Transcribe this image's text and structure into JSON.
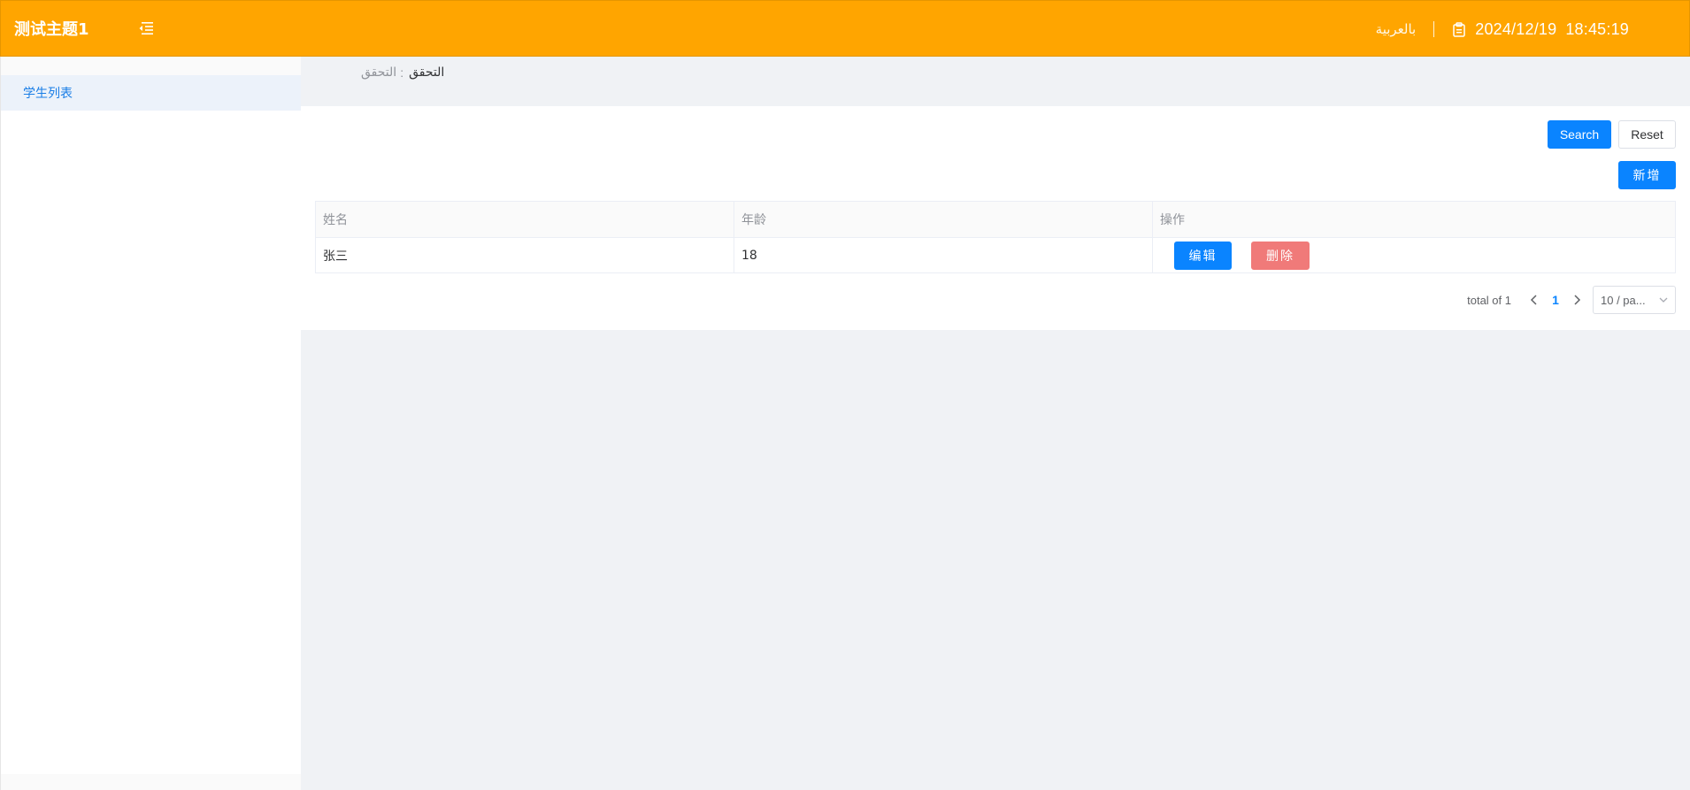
{
  "header": {
    "title": "测试主题1",
    "language": "بالعربية",
    "date": "2024/12/19",
    "time": "18:45:19",
    "background_color": "#ffa500"
  },
  "sidebar": {
    "items": [
      {
        "label": "学生列表",
        "active": true
      }
    ]
  },
  "breadcrumb": {
    "parent": "التحقق",
    "separator": ":",
    "current": "التحقق"
  },
  "toolbar": {
    "search_label": "Search",
    "reset_label": "Reset",
    "add_label": "新增"
  },
  "table": {
    "columns": [
      "姓名",
      "年龄",
      "操作"
    ],
    "rows": [
      {
        "name": "张三",
        "age": "18",
        "edit_label": "编辑",
        "delete_label": "删除"
      }
    ]
  },
  "pagination": {
    "total_text": "total of 1",
    "current_page": "1",
    "page_size": "10 / pa..."
  },
  "icons": {
    "menu_toggle": "outdent-icon",
    "calendar": "calendar-icon",
    "prev": "chevron-left-icon",
    "next": "chevron-right-icon",
    "dropdown": "chevron-down-icon"
  },
  "colors": {
    "primary": "#0a84ff",
    "danger": "#f07a79",
    "sidebar_active_bg": "#ecf2fa"
  }
}
